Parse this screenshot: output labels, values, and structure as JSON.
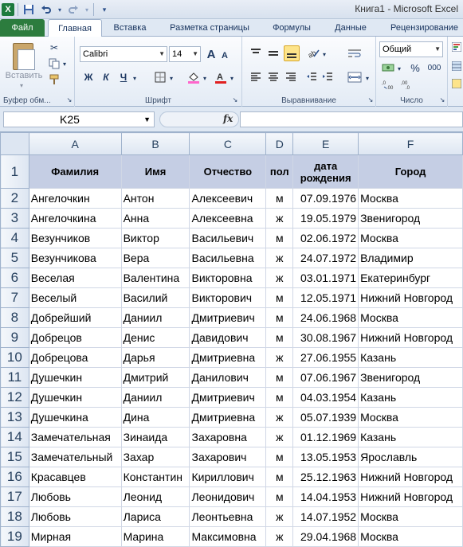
{
  "window": {
    "title": "Книга1 - Microsoft Excel",
    "app_icon": "X"
  },
  "qat": {
    "save_icon": "save-icon",
    "undo_icon": "undo-icon",
    "redo_icon": "redo-icon"
  },
  "tabs": [
    {
      "label": "Файл"
    },
    {
      "label": "Главная"
    },
    {
      "label": "Вставка"
    },
    {
      "label": "Разметка страницы"
    },
    {
      "label": "Формулы"
    },
    {
      "label": "Данные"
    },
    {
      "label": "Рецензирование"
    }
  ],
  "ribbon": {
    "clipboard": {
      "label": "Буфер обм...",
      "paste": "Вставить"
    },
    "font": {
      "label": "Шрифт",
      "name": "Calibri",
      "size": "14",
      "bold": "Ж",
      "italic": "К",
      "underline": "Ч",
      "grow": "A",
      "shrink": "A"
    },
    "alignment": {
      "label": "Выравнивание"
    },
    "number": {
      "label": "Число",
      "format": "Общий",
      "percent": "%",
      "thousands": "000"
    }
  },
  "formula_bar": {
    "name_box": "K25",
    "fx": "fx",
    "value": ""
  },
  "sheet": {
    "columns": [
      "A",
      "B",
      "C",
      "D",
      "E",
      "F"
    ],
    "header_row": [
      "Фамилия",
      "Имя",
      "Отчество",
      "пол",
      "дата рождения",
      "Город"
    ],
    "rows": [
      [
        "Ангелочкин",
        "Антон",
        "Алексеевич",
        "м",
        "07.09.1976",
        "Москва"
      ],
      [
        "Ангелочкина",
        "Анна",
        "Алексеевна",
        "ж",
        "19.05.1979",
        "Звенигород"
      ],
      [
        "Везунчиков",
        "Виктор",
        "Васильевич",
        "м",
        "02.06.1972",
        "Москва"
      ],
      [
        "Везунчикова",
        "Вера",
        "Васильевна",
        "ж",
        "24.07.1972",
        "Владимир"
      ],
      [
        "Веселая",
        "Валентина",
        "Викторовна",
        "ж",
        "03.01.1971",
        "Екатеринбург"
      ],
      [
        "Веселый",
        "Василий",
        "Викторович",
        "м",
        "12.05.1971",
        "Нижний Новгород"
      ],
      [
        "Добрейший",
        "Даниил",
        "Дмитриевич",
        "м",
        "24.06.1968",
        "Москва"
      ],
      [
        "Добрецов",
        "Денис",
        "Давидович",
        "м",
        "30.08.1967",
        "Нижний Новгород"
      ],
      [
        "Добрецова",
        "Дарья",
        "Дмитриевна",
        "ж",
        "27.06.1955",
        "Казань"
      ],
      [
        "Душечкин",
        "Дмитрий",
        "Данилович",
        "м",
        "07.06.1967",
        "Звенигород"
      ],
      [
        "Душечкин",
        "Даниил",
        "Дмитриевич",
        "м",
        "04.03.1954",
        "Казань"
      ],
      [
        "Душечкина",
        "Дина",
        "Дмитриевна",
        "ж",
        "05.07.1939",
        "Москва"
      ],
      [
        "Замечательная",
        "Зинаида",
        "Захаровна",
        "ж",
        "01.12.1969",
        "Казань"
      ],
      [
        "Замечательный",
        "Захар",
        "Захарович",
        "м",
        "13.05.1953",
        "Ярославль"
      ],
      [
        "Красавцев",
        "Константин",
        "Кириллович",
        "м",
        "25.12.1963",
        "Нижний Новгород"
      ],
      [
        "Любовь",
        "Леонид",
        "Леонидович",
        "м",
        "14.04.1953",
        "Нижний Новгород"
      ],
      [
        "Любовь",
        "Лариса",
        "Леонтьевна",
        "ж",
        "14.07.1952",
        "Москва"
      ],
      [
        "Мирная",
        "Марина",
        "Максимовна",
        "ж",
        "29.04.1968",
        "Москва"
      ]
    ]
  }
}
